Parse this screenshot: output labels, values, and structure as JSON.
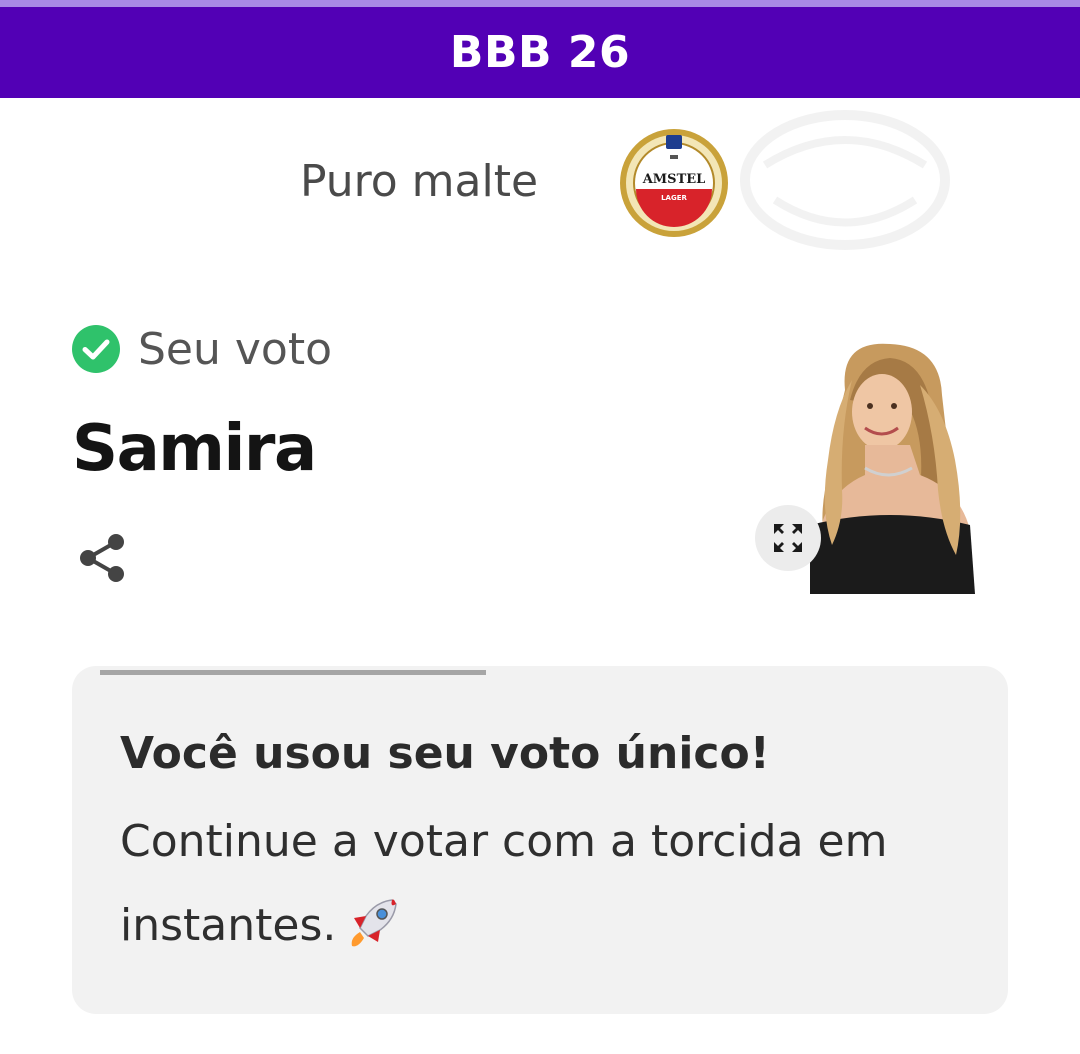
{
  "header": {
    "title": "BBB 26",
    "color": "#5200b5"
  },
  "sponsor": {
    "text": "Puro malte",
    "logo": {
      "icon": "amstel-logo-icon",
      "brand": "AMSTEL",
      "sub": "LAGER"
    }
  },
  "vote": {
    "status_label": "Seu voto",
    "status_icon": "check-circle-icon",
    "status_color": "#2fc26b",
    "candidate_name": "Samira",
    "share_icon": "share-icon",
    "expand_icon": "expand-icon"
  },
  "notice": {
    "progress": 1.0,
    "title": "Você usou seu voto único!",
    "body": "Continue a votar com a torcida em instantes.",
    "emoji_icon": "rocket-icon"
  }
}
